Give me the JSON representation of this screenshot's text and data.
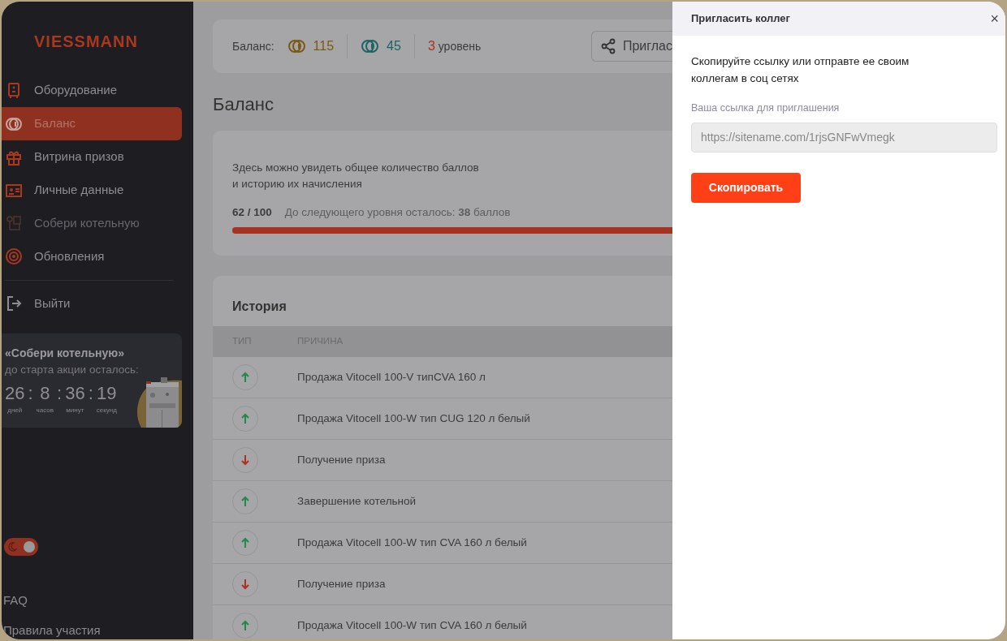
{
  "sidebar": {
    "logo": "VIESSMANN",
    "items": [
      {
        "label": "Оборудование",
        "selected": false,
        "disabled": false
      },
      {
        "label": "Баланс",
        "selected": true,
        "disabled": false
      },
      {
        "label": "Витрина призов",
        "selected": false,
        "disabled": false
      },
      {
        "label": "Личные данные",
        "selected": false,
        "disabled": false
      },
      {
        "label": "Собери котельную",
        "selected": false,
        "disabled": true
      },
      {
        "label": "Обновления",
        "selected": false,
        "disabled": false
      }
    ],
    "logout": "Выйти",
    "promo": {
      "title": "«Собери котельную»",
      "subtitle": "до старта акции осталось:",
      "timer": [
        {
          "value": "26",
          "unit": "дней"
        },
        {
          "value": "8",
          "unit": "часов"
        },
        {
          "value": "36",
          "unit": "минут"
        },
        {
          "value": "19",
          "unit": "секунд"
        }
      ],
      "separator": ":"
    },
    "theme_toggle": {
      "on": true
    },
    "links": [
      "FAQ",
      "Правила участия"
    ]
  },
  "topbar": {
    "balance_label": "Баланс:",
    "coins": [
      {
        "value": "115",
        "color": "#7a5a12"
      },
      {
        "value": "45",
        "color": "#1d6465"
      }
    ],
    "level": {
      "number": "3",
      "text": "уровень"
    },
    "invite_button": "Приглас"
  },
  "page_title": "Баланс",
  "summary": {
    "description": "Здесь можно увидеть общее количество баллов\nи историю их начисления",
    "progress": "62 / 100",
    "progress_note": "До следующего уровня осталось: **38** баллов",
    "level": 0.62
  },
  "history": {
    "title": "История",
    "columns": [
      "ТИП",
      "ПРИЧИНА"
    ],
    "rows": [
      {
        "kind": "up",
        "reason": "Продажа Vitocell 100-V типCVA 160 л"
      },
      {
        "kind": "up",
        "reason": "Продажа Vitocell 100-W тип CUG 120 л белый"
      },
      {
        "kind": "down",
        "reason": "Получение приза"
      },
      {
        "kind": "up",
        "reason": "Завершение котельной"
      },
      {
        "kind": "up",
        "reason": "Продажа Vitocell 100-W тип CVA 160 л белый"
      },
      {
        "kind": "down",
        "reason": "Получение приза"
      },
      {
        "kind": "up",
        "reason": "Продажа Vitocell 100-W тип CVA 160 л белый"
      }
    ]
  },
  "drawer": {
    "title": "Пригласить коллег",
    "close": "×",
    "text": "Скопируйте ссылку или отправте ее своим\nколлегам в соц сетях",
    "field_label": "Ваша ссылка для приглашения",
    "link": "https://sitename.com/1rjsGNFwVmegk",
    "button": "Скопировать"
  }
}
